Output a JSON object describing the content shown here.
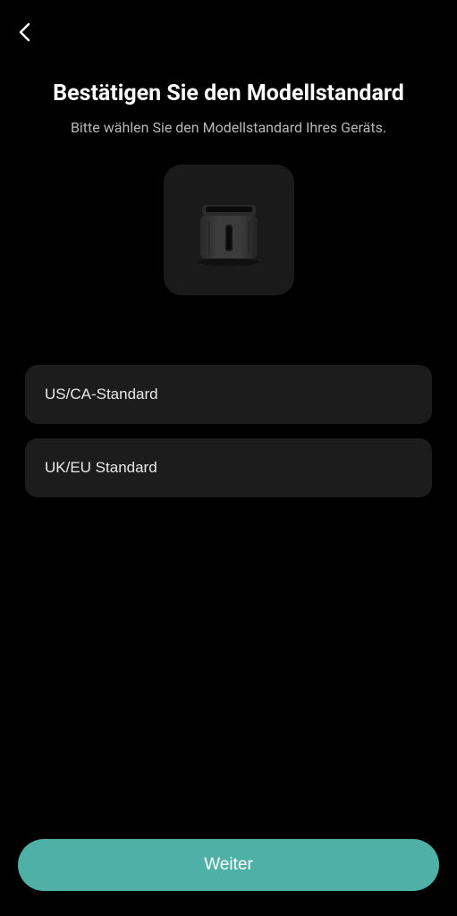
{
  "header": {
    "backIcon": "chevron-left"
  },
  "page": {
    "title": "Bestätigen Sie den Modellstandard",
    "subtitle": "Bitte wählen Sie den Modellstandard Ihres Geräts."
  },
  "product": {
    "name": "air-fryer"
  },
  "options": [
    {
      "label": "US/CA-Standard"
    },
    {
      "label": "UK/EU Standard"
    }
  ],
  "actions": {
    "primary": "Weiter"
  },
  "colors": {
    "accent": "#4fb0a8",
    "background": "#000000",
    "card": "#1a1a1a",
    "option": "#1c1c1c"
  }
}
